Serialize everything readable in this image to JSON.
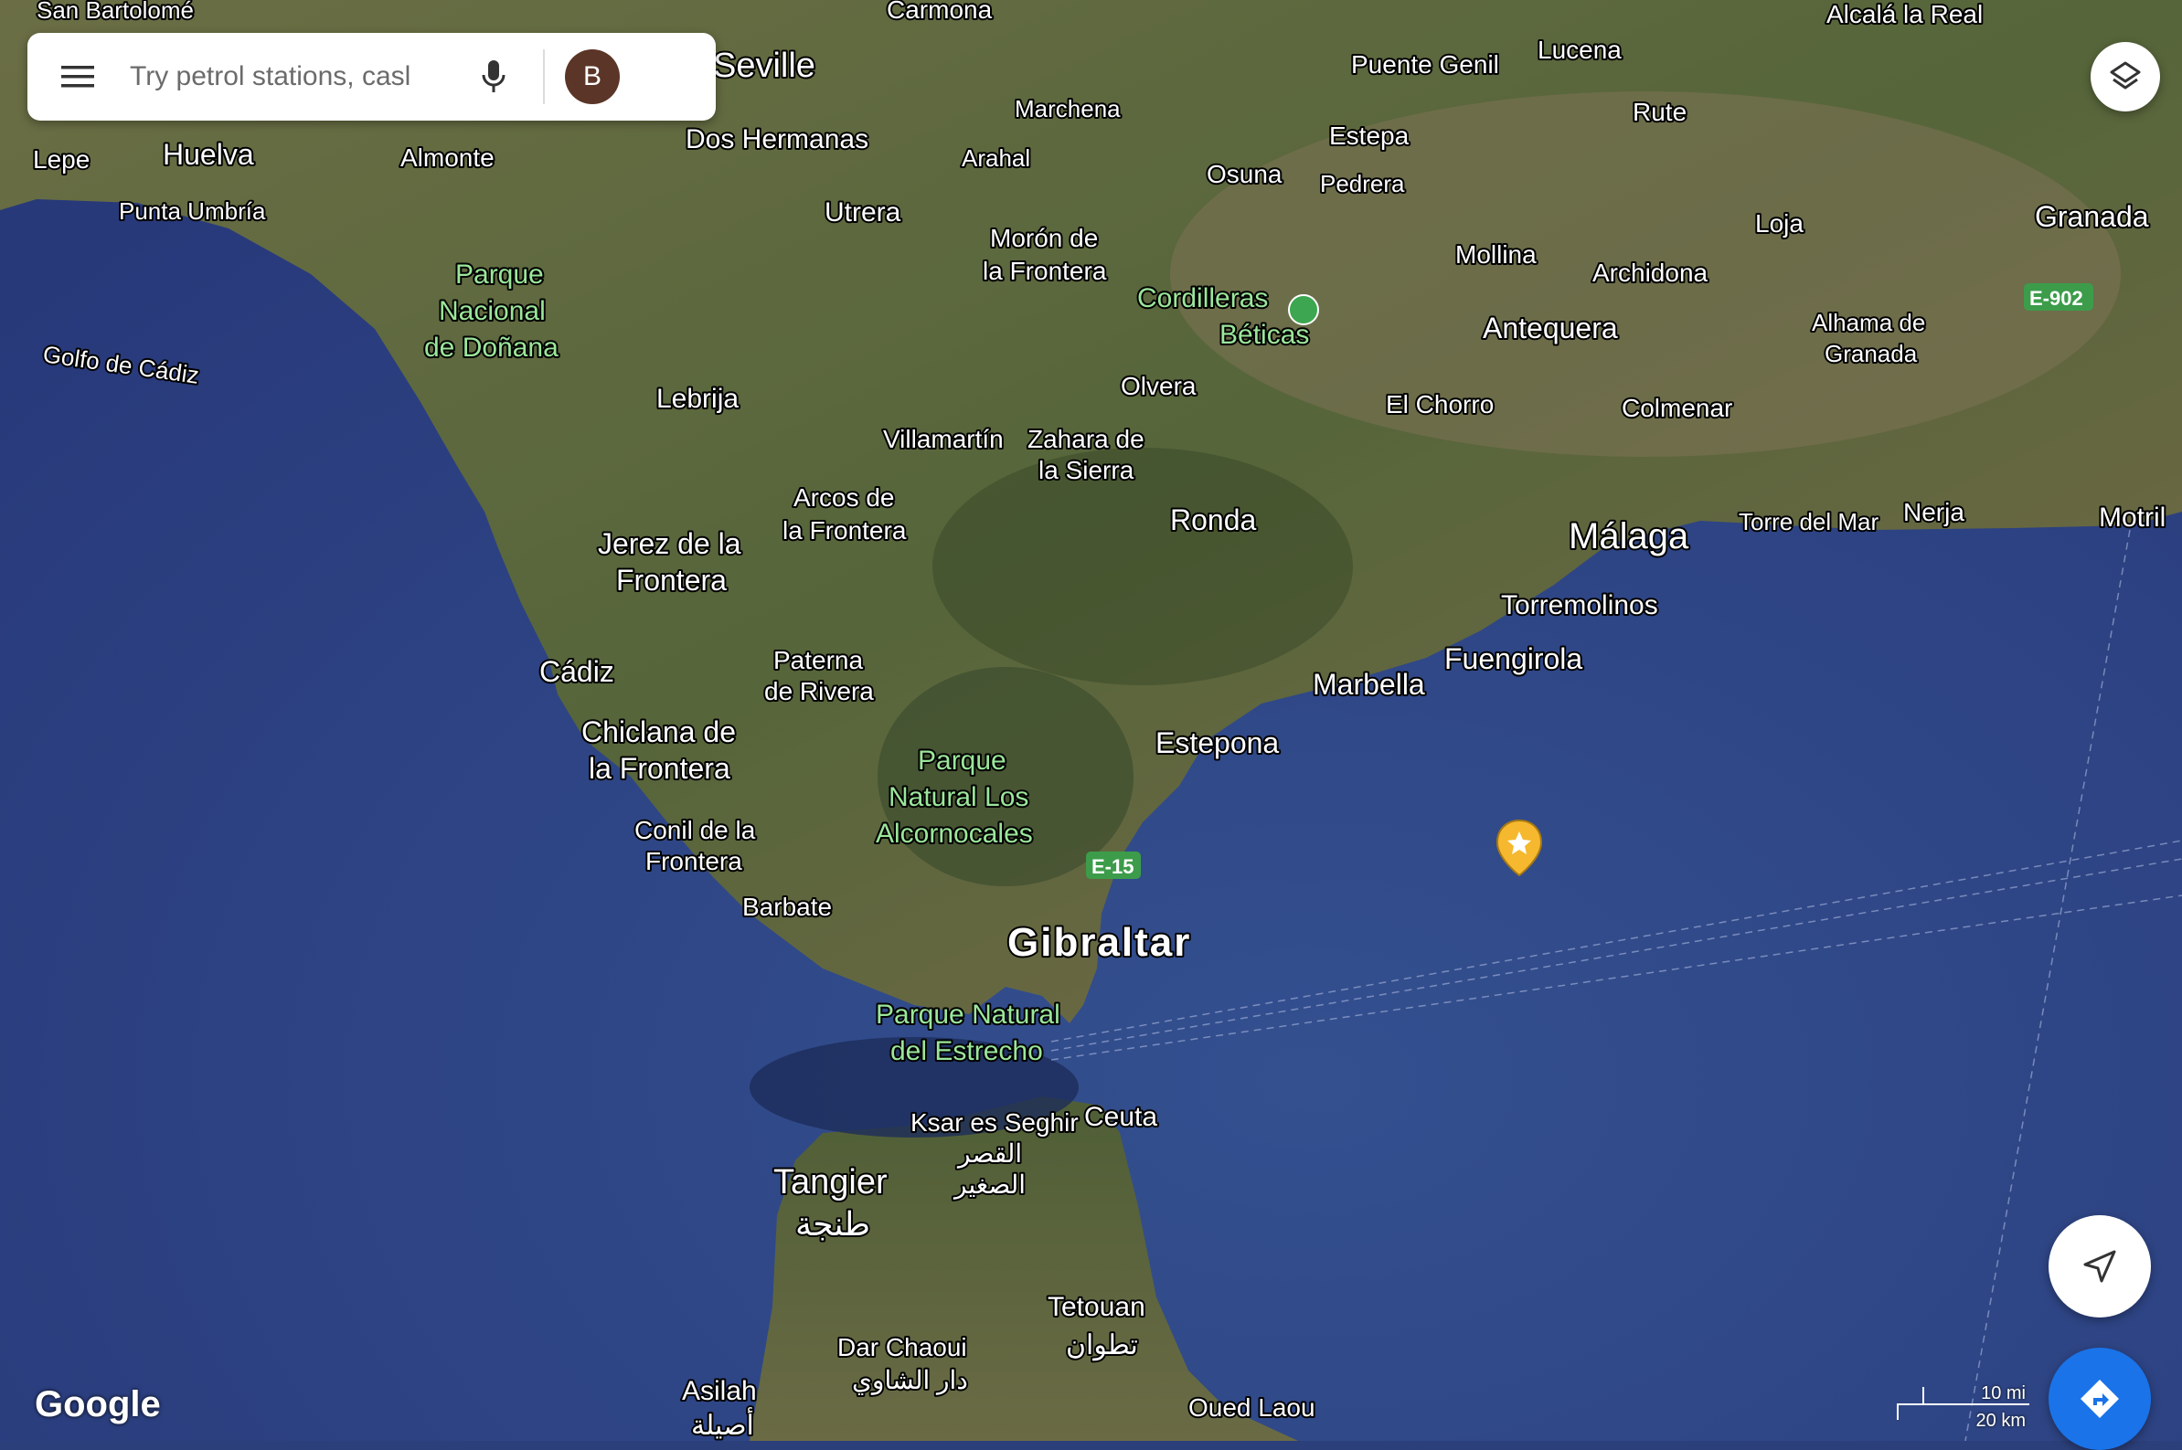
{
  "search": {
    "placeholder": "Try petrol stations, casl"
  },
  "account": {
    "initial": "B"
  },
  "brand": {
    "logo_text": "Google"
  },
  "scale": {
    "mi": "10 mi",
    "km": "20 km"
  },
  "colors": {
    "sea": "#2e4585",
    "land": "#5b6b3c",
    "avatar": "#5b3527",
    "directions": "#1a73e8",
    "pin": "#f5b82e"
  },
  "icons": {
    "menu": "menu-icon",
    "mic": "mic-icon",
    "layers": "layers-icon",
    "locate": "navigation-arrow-icon",
    "directions": "directions-icon",
    "pin": "star-pin-icon",
    "park": "park-marker-icon"
  },
  "labels": {
    "san_bartolome": "San Bartolomé",
    "carmona": "Carmona",
    "alcala": "Alcalá la Real",
    "seville": "Seville",
    "puente_genil": "Puente Genil",
    "lucena": "Lucena",
    "lepe": "Lepe",
    "huelva": "Huelva",
    "almonte": "Almonte",
    "dos_hermanas": "Dos Hermanas",
    "marchena": "Marchena",
    "arahal": "Arahal",
    "estepa": "Estepa",
    "osuna": "Osuna",
    "pedrera": "Pedrera",
    "rute": "Rute",
    "punta_umbria": "Punta Umbría",
    "utrera": "Utrera",
    "loja": "Loja",
    "granada": "Granada",
    "moron_1": "Morón de",
    "moron_2": "la Frontera",
    "mollina": "Mollina",
    "archidona": "Archidona",
    "donana_1": "Parque",
    "donana_2": "Nacional",
    "donana_3": "de Doñana",
    "cordilleras_1": "Cordilleras",
    "cordilleras_2": "Béticas",
    "e902": "E-902",
    "antequera": "Antequera",
    "alhama_1": "Alhama de",
    "alhama_2": "Granada",
    "golfo": "Golfo de Cádiz",
    "olvera": "Olvera",
    "lebrija": "Lebrija",
    "el_chorro": "El Chorro",
    "colmenar": "Colmenar",
    "villamartin": "Villamartín",
    "zahara_1": "Zahara de",
    "zahara_2": "la Sierra",
    "arcos_1": "Arcos de",
    "arcos_2": "la Frontera",
    "ronda": "Ronda",
    "malaga": "Málaga",
    "torre_del_mar": "Torre del Mar",
    "nerja": "Nerja",
    "motril": "Motril",
    "jerez_1": "Jerez de la",
    "jerez_2": "Frontera",
    "torremolinos": "Torremolinos",
    "paterna_1": "Paterna",
    "paterna_2": "de Rivera",
    "cadiz": "Cádiz",
    "fuengirola": "Fuengirola",
    "marbella": "Marbella",
    "chiclana_1": "Chiclana de",
    "chiclana_2": "la Frontera",
    "estepona": "Estepona",
    "alcornocales_1": "Parque",
    "alcornocales_2": "Natural Los",
    "alcornocales_3": "Alcornocales",
    "conil_1": "Conil de la",
    "conil_2": "Frontera",
    "e15": "E-15",
    "barbate": "Barbate",
    "gibraltar": "Gibraltar",
    "estrecho_1": "Parque Natural",
    "estrecho_2": "del Estrecho",
    "ksar_1": "Ksar es Seghir",
    "ksar_2": "القصر",
    "ksar_3": "الصغير",
    "ceuta": "Ceuta",
    "tangier_1": "Tangier",
    "tangier_2": "طنجة",
    "tetouan_1": "Tetouan",
    "tetouan_2": "تطوان",
    "dar_chaoui_1": "Dar Chaoui",
    "dar_chaoui_2": "دار الشاوي",
    "asilah_1": "Asilah",
    "asilah_2": "أصيلة",
    "oued_laou": "Oued Laou"
  }
}
